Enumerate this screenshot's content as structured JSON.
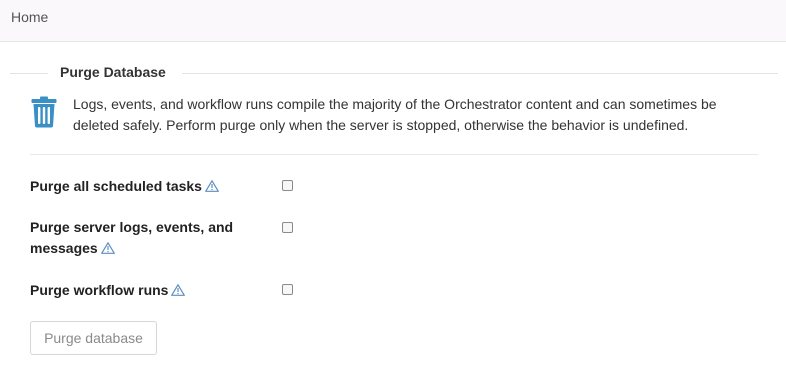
{
  "breadcrumb": {
    "home_label": "Home"
  },
  "section": {
    "title": "Purge Database",
    "icon": "trash-icon",
    "description": "Logs, events, and workflow runs compile the majority of the Orchestrator content and can sometimes be deleted safely. Perform purge only when the server is stopped, otherwise the behavior is undefined."
  },
  "options": [
    {
      "label": "Purge all scheduled tasks",
      "checked": false,
      "icon": "warning-icon"
    },
    {
      "label": "Purge server logs, events, and messages",
      "checked": false,
      "icon": "warning-icon"
    },
    {
      "label": "Purge workflow runs",
      "checked": false,
      "icon": "warning-icon"
    }
  ],
  "actions": {
    "purge_label": "Purge database"
  },
  "colors": {
    "icon_blue": "#3a8fc4",
    "topbar_bg": "#fbf8fc"
  }
}
